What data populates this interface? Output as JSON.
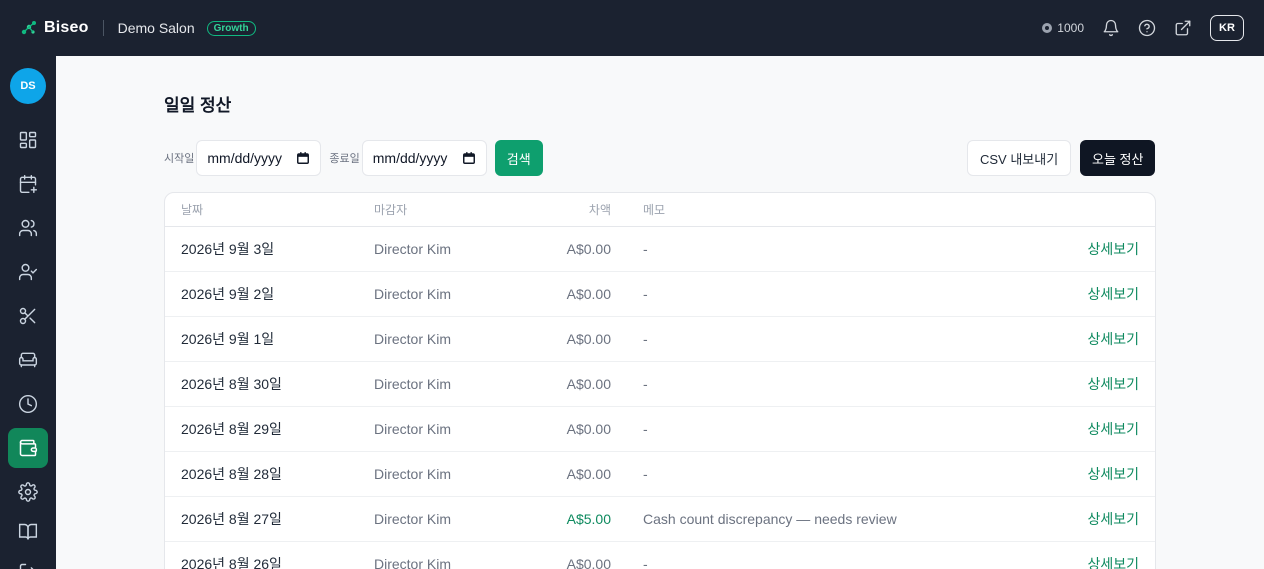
{
  "topbar": {
    "brand": "Biseo",
    "salon": "Demo Salon",
    "plan": "Growth",
    "credits": "1000",
    "language": "KR"
  },
  "sidebar": {
    "avatar": "DS",
    "items": [
      {
        "icon": "dashboard-icon"
      },
      {
        "icon": "calendar-add-icon"
      },
      {
        "icon": "users-icon"
      },
      {
        "icon": "user-check-icon"
      },
      {
        "icon": "scissors-icon"
      },
      {
        "icon": "sofa-icon"
      },
      {
        "icon": "clock-icon"
      },
      {
        "icon": "wallet-icon",
        "active": true
      },
      {
        "icon": "gear-icon"
      },
      {
        "icon": "book-icon"
      },
      {
        "icon": "logout-icon"
      }
    ]
  },
  "page": {
    "title": "일일 정산",
    "start_label": "시작일",
    "end_label": "종료일",
    "start_value": "mm/dd/yyyy",
    "end_value": "mm/dd/yyyy",
    "search_label": "검색",
    "csv_label": "CSV 내보내기",
    "today_label": "오늘 정산"
  },
  "table": {
    "headers": {
      "date": "날짜",
      "closer": "마감자",
      "diff": "차액",
      "memo": "메모"
    },
    "action_label": "상세보기",
    "rows": [
      {
        "date": "2026년 9월 3일",
        "closer": "Director Kim",
        "diff": "A$0.00",
        "memo": "-"
      },
      {
        "date": "2026년 9월 2일",
        "closer": "Director Kim",
        "diff": "A$0.00",
        "memo": "-"
      },
      {
        "date": "2026년 9월 1일",
        "closer": "Director Kim",
        "diff": "A$0.00",
        "memo": "-"
      },
      {
        "date": "2026년 8월 30일",
        "closer": "Director Kim",
        "diff": "A$0.00",
        "memo": "-"
      },
      {
        "date": "2026년 8월 29일",
        "closer": "Director Kim",
        "diff": "A$0.00",
        "memo": "-"
      },
      {
        "date": "2026년 8월 28일",
        "closer": "Director Kim",
        "diff": "A$0.00",
        "memo": "-"
      },
      {
        "date": "2026년 8월 27일",
        "closer": "Director Kim",
        "diff": "A$5.00",
        "memo": "Cash count discrepancy — needs review",
        "positive": true
      },
      {
        "date": "2026년 8월 26일",
        "closer": "Director Kim",
        "diff": "A$0.00",
        "memo": "-"
      }
    ]
  },
  "colors": {
    "nav_bg": "#1b2230",
    "accent": "#0e9f6e",
    "active_nav": "#11875a",
    "avatar_bg": "#0ea5e9"
  }
}
